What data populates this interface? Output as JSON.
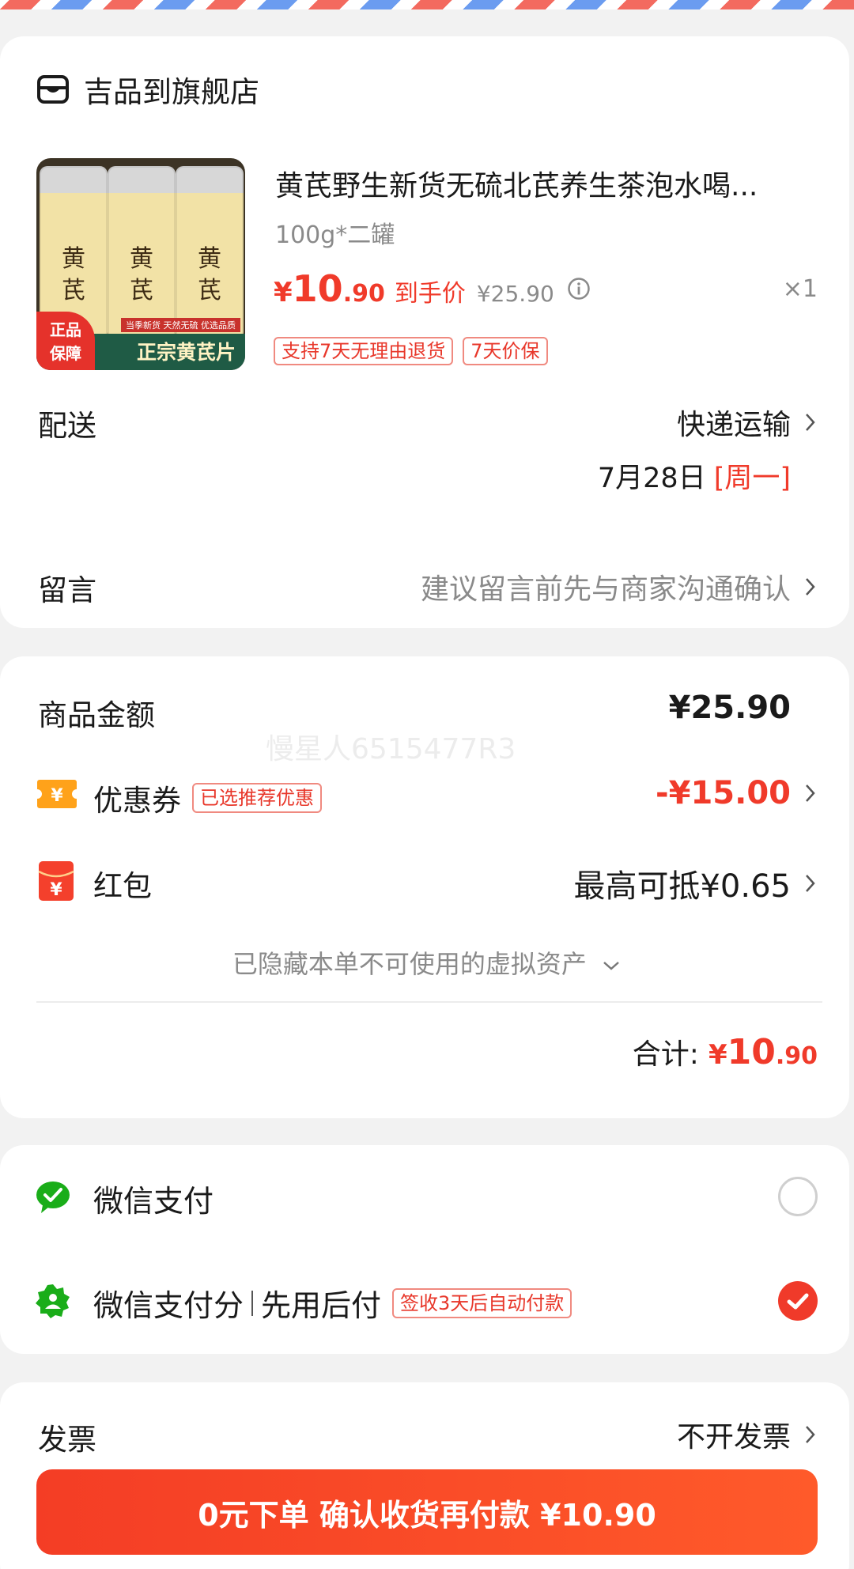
{
  "store": {
    "name": "吉品到旗舰店",
    "icon": "store-icon"
  },
  "product": {
    "title": "黄芪野生新货无硫北芪养生茶泡水喝...",
    "spec": "100g*二罐",
    "price_symbol": "¥",
    "price_int": "10",
    "price_dec": ".90",
    "price_label": "到手价",
    "original_price": "¥25.90",
    "quantity": "×1",
    "tags": [
      "支持7天无理由退货",
      "7天价保"
    ],
    "image": {
      "jar_label_top": "黄",
      "jar_label_bottom": "芪",
      "badge_line1": "正品",
      "badge_line2": "保障",
      "banner": "正宗黄芪片",
      "topline": "当季新货 天然无硫 优选品质"
    }
  },
  "delivery": {
    "label": "配送",
    "method": "快递运输",
    "date": "7月28日",
    "weekday": "[周一]"
  },
  "message": {
    "label": "留言",
    "placeholder": "建议留言前先与商家沟通确认"
  },
  "watermark": "慢星人6515477R3",
  "amounts": {
    "goods_label": "商品金额",
    "goods_value": "¥25.90",
    "coupon_label": "优惠券",
    "coupon_tag": "已选推荐优惠",
    "coupon_value": "-¥15.00",
    "hongbao_label": "红包",
    "hongbao_value": "最高可抵¥0.65",
    "hidden_assets": "已隐藏本单不可使用的虚拟资产",
    "total_label": "合计:",
    "total_symbol": "¥",
    "total_int": "10",
    "total_dec": ".90"
  },
  "payment": {
    "wechat_pay": "微信支付",
    "wechat_score": "微信支付分",
    "pay_later": "先用后付",
    "pay_later_tag": "签收3天后自动付款",
    "selected": "wechat_score"
  },
  "invoice": {
    "label": "发票",
    "value": "不开发票"
  },
  "cta": {
    "label": "0元下单 确认收货再付款 ¥10.90"
  },
  "colors": {
    "accent": "#f03a2a",
    "wechat_green": "#1aad19"
  }
}
